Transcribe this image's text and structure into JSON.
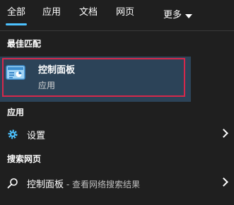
{
  "tabs": [
    {
      "label": "全部"
    },
    {
      "label": "应用"
    },
    {
      "label": "文档"
    },
    {
      "label": "网页"
    },
    {
      "label": "更多"
    }
  ],
  "best_match": {
    "section": "最佳匹配",
    "title": "控制面板",
    "subtitle": "应用"
  },
  "apps": {
    "section": "应用",
    "item_label": "设置"
  },
  "web": {
    "section": "搜索网页",
    "item_label": "控制面板",
    "item_suffix": " - 查看网络搜索结果"
  },
  "colors": {
    "accent": "#4cc2ff",
    "highlight_border": "#d6284b",
    "selected_bg": "#2c4358",
    "background": "#1f1f1f"
  }
}
